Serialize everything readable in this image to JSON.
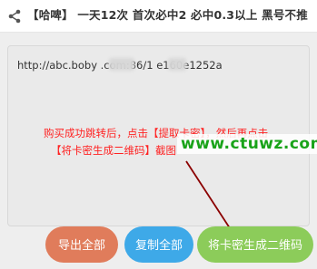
{
  "header": {
    "share_icon": "share-icon",
    "title": "【哈啤】 一天12次 首次必中2 必中0.3以上 黑号不推"
  },
  "text_panel": {
    "url_text": "http://abc.boby   .com:86/1   e160e1252a"
  },
  "annotation": {
    "instruction_line1": "购买成功跳转后，点击【提取卡密】，然后再点击",
    "instruction_line2": "【将卡密生成二维码】截图",
    "watermark": "www.ctuwz.com",
    "arrow_color": "#8b0000",
    "text_color": "#ff2222",
    "watermark_color": "#19a319"
  },
  "buttons": {
    "export_label": "导出全部",
    "copy_label": "复制全部",
    "qr_label": "将卡密生成二维码",
    "export_color": "#e07c5b",
    "copy_color": "#3ea9e8",
    "qr_color": "#8ccc5a"
  }
}
